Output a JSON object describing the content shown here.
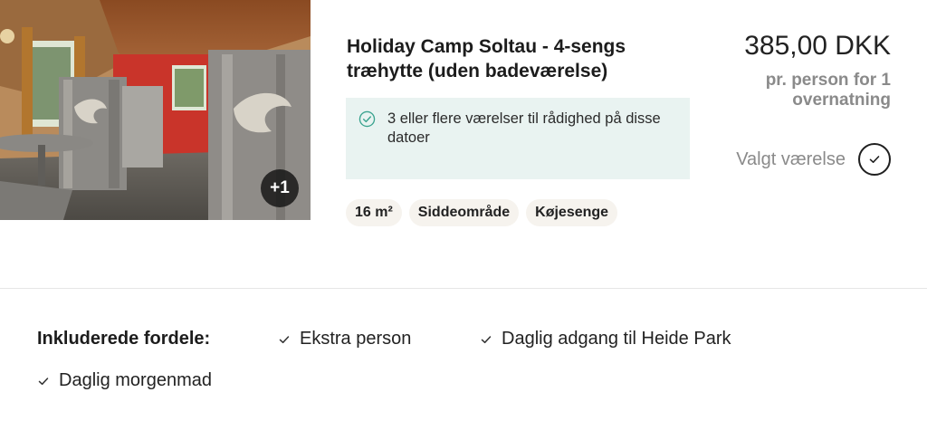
{
  "room": {
    "title": "Holiday Camp Soltau - 4-sengs træhytte (uden badeværelse)",
    "photo_badge": "+1",
    "availability": "3 eller flere værelser til rådighed på disse datoer",
    "features": [
      "16 m²",
      "Siddeområde",
      "Køjesenge"
    ],
    "price": "385,00 DKK",
    "price_note": "pr. person for 1 overnatning",
    "select_label": "Valgt værelse"
  },
  "benefits": {
    "heading": "Inkluderede fordele:",
    "items": [
      "Ekstra person",
      "Daglig adgang til Heide Park",
      "Daglig morgenmad"
    ]
  },
  "icons": {
    "availability": "check-circle-icon",
    "select": "check-circle-icon",
    "benefit": "checkmark-icon"
  },
  "colors": {
    "availability_bg": "#e9f3f1",
    "availability_icon": "#3aa38f",
    "chip_bg": "#f6f3ee",
    "muted_text": "#8a8a8a"
  }
}
